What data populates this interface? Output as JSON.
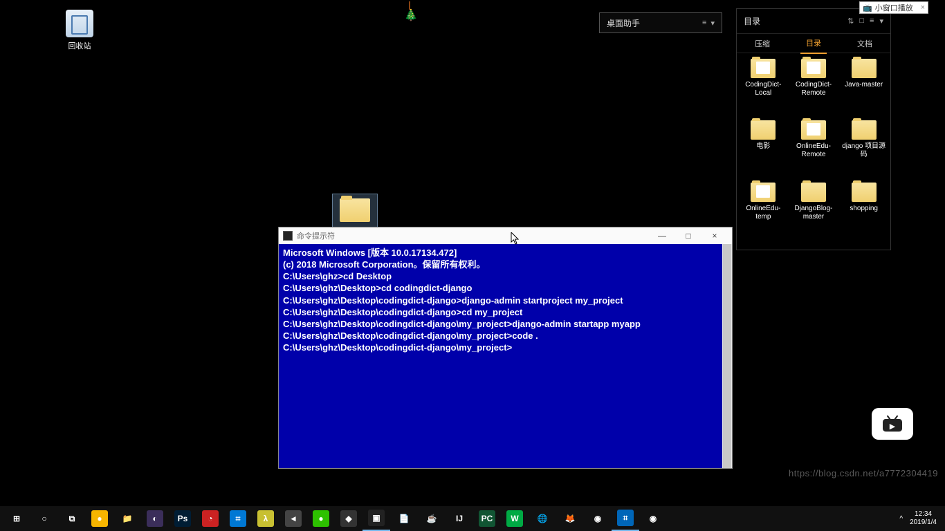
{
  "desktop": {
    "recycle_bin": "回收站"
  },
  "helper_bar": {
    "label": "桌面助手",
    "icon1": "≡",
    "icon2": "▾"
  },
  "dir_panel": {
    "title": "目录",
    "icon1": "⇅",
    "icon2": "□",
    "icon3": "≡",
    "icon4": "▾",
    "tabs": {
      "compress": "压缩",
      "directory": "目录",
      "archive": "文档"
    },
    "items": [
      "CodingDict-Local",
      "CodingDict-Remote",
      "Java-master",
      "电影",
      "OnlineEdu-Remote",
      "django 项目源码",
      "OnlineEdu-temp",
      "DjangoBlog-master",
      "shopping"
    ]
  },
  "pill": {
    "label": "小窗口播放",
    "close": "×"
  },
  "cmd": {
    "title": "命令提示符",
    "min": "—",
    "max": "□",
    "close": "×",
    "lines": [
      "Microsoft Windows [版本 10.0.17134.472]",
      "(c) 2018 Microsoft Corporation。保留所有权利。",
      "",
      "C:\\Users\\ghz>cd Desktop",
      "",
      "C:\\Users\\ghz\\Desktop>cd codingdict-django",
      "",
      "C:\\Users\\ghz\\Desktop\\codingdict-django>django-admin startproject my_project",
      "",
      "C:\\Users\\ghz\\Desktop\\codingdict-django>cd my_project",
      "",
      "C:\\Users\\ghz\\Desktop\\codingdict-django\\my_project>django-admin startapp myapp",
      "",
      "C:\\Users\\ghz\\Desktop\\codingdict-django\\my_project>code .",
      "",
      "C:\\Users\\ghz\\Desktop\\codingdict-django\\my_project>"
    ]
  },
  "taskbar": {
    "items": [
      {
        "name": "start",
        "glyph": "⊞",
        "bg": ""
      },
      {
        "name": "cortana",
        "glyph": "○",
        "bg": ""
      },
      {
        "name": "taskview",
        "glyph": "⧉",
        "bg": ""
      },
      {
        "name": "360",
        "glyph": "●",
        "bg": "#f7b500"
      },
      {
        "name": "explorer",
        "glyph": "📁",
        "bg": ""
      },
      {
        "name": "eclipse",
        "glyph": "◐",
        "bg": "#3b2e5a"
      },
      {
        "name": "photoshop",
        "glyph": "Ps",
        "bg": "#001d34"
      },
      {
        "name": "app-red",
        "glyph": "◔",
        "bg": "#c22"
      },
      {
        "name": "vscode1",
        "glyph": "⌗",
        "bg": "#0078d4"
      },
      {
        "name": "lambda",
        "glyph": "λ",
        "bg": "#c8c032"
      },
      {
        "name": "sublime",
        "glyph": "◄",
        "bg": "#444"
      },
      {
        "name": "wechat",
        "glyph": "●",
        "bg": "#2dc100"
      },
      {
        "name": "app-dark",
        "glyph": "◆",
        "bg": "#333"
      },
      {
        "name": "cmd",
        "glyph": "▣",
        "bg": "#222"
      },
      {
        "name": "notepadpp",
        "glyph": "📄",
        "bg": ""
      },
      {
        "name": "java",
        "glyph": "☕",
        "bg": ""
      },
      {
        "name": "intellij",
        "glyph": "IJ",
        "bg": "#111"
      },
      {
        "name": "pycharm",
        "glyph": "PC",
        "bg": "#153"
      },
      {
        "name": "webstorm",
        "glyph": "W",
        "bg": "#0a4"
      },
      {
        "name": "globe",
        "glyph": "🌐",
        "bg": ""
      },
      {
        "name": "firefox",
        "glyph": "🦊",
        "bg": ""
      },
      {
        "name": "chrome1",
        "glyph": "◉",
        "bg": ""
      },
      {
        "name": "vscode2",
        "glyph": "⌗",
        "bg": "#0066b8"
      },
      {
        "name": "chrome2",
        "glyph": "◉",
        "bg": ""
      }
    ]
  },
  "tray": {
    "up": "^",
    "time": "12:34",
    "date": "2019/1/4"
  },
  "watermark": "https://blog.csdn.net/a7772304419"
}
